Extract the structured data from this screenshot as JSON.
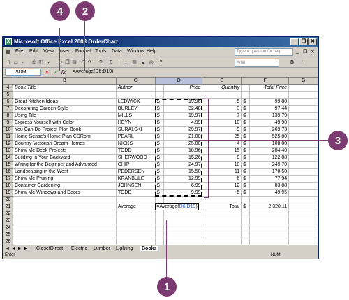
{
  "callouts": {
    "c1": "1",
    "c2": "2",
    "c3": "3",
    "c4": "4"
  },
  "window": {
    "title": "Microsoft Office Excel 2003 OrderChart",
    "app_icon": "X",
    "controls": [
      "_",
      "❐",
      "✕"
    ]
  },
  "menu": {
    "items": [
      "File",
      "Edit",
      "View",
      "Insert",
      "Format",
      "Tools",
      "Data",
      "Window",
      "Help"
    ],
    "ask_placeholder": "Type a question for help",
    "doc_controls": [
      "_",
      "❐",
      "✕"
    ]
  },
  "toolbar": {
    "font_placeholder": "Arial",
    "bold": "B",
    "italic": "I",
    "autosum": "Σ"
  },
  "formula": {
    "namebox": "SUM",
    "cancel": "✕",
    "enter": "✓",
    "fx": "fx",
    "text": "=Average(D6:D19)"
  },
  "sheet": {
    "columns": [
      "B",
      "C",
      "D",
      "E",
      "F",
      "G"
    ],
    "rows": [
      {
        "n": "4",
        "b": "Book Title",
        "c": "Author",
        "d$": "",
        "d": "Price",
        "e": "Quantity",
        "f$": "",
        "f": "Total Price",
        "italic": true
      },
      {
        "n": "5",
        "b": "",
        "c": "",
        "d$": "",
        "d": "",
        "e": "",
        "f$": "",
        "f": ""
      },
      {
        "n": "6",
        "b": "Great Kitchen Ideas",
        "c": "LEDWICK",
        "d$": "$",
        "d": "19.96",
        "e": "5",
        "f$": "$",
        "f": "99.80"
      },
      {
        "n": "7",
        "b": "Decorating Garden Style",
        "c": "BURLEY",
        "d$": "$",
        "d": "32.48",
        "e": "3",
        "f$": "$",
        "f": "97.44"
      },
      {
        "n": "8",
        "b": "Using Tile",
        "c": "MILLS",
        "d$": "$",
        "d": "19.97",
        "e": "7",
        "f$": "$",
        "f": "139.79"
      },
      {
        "n": "9",
        "b": "Express Yourself with Color",
        "c": "HEYN",
        "d$": "$",
        "d": "4.99",
        "e": "10",
        "f$": "$",
        "f": "49.90"
      },
      {
        "n": "10",
        "b": "You Can Do Project Plan Book",
        "c": "SURALSKI",
        "d$": "$",
        "d": "29.97",
        "e": "9",
        "f$": "$",
        "f": "269.73"
      },
      {
        "n": "11",
        "b": "Home Sense's Home Plan CDRom",
        "c": "PEARL",
        "d$": "$",
        "d": "21.00",
        "e": "25",
        "f$": "$",
        "f": "525.00"
      },
      {
        "n": "12",
        "b": "Country Victorian Dream Homes",
        "c": "NICKS",
        "d$": "$",
        "d": "25.00",
        "e": "4",
        "f$": "$",
        "f": "100.00"
      },
      {
        "n": "13",
        "b": "Show Me Deck Projects",
        "c": "TODD",
        "d$": "$",
        "d": "18.96",
        "e": "15",
        "f$": "$",
        "f": "284.40"
      },
      {
        "n": "14",
        "b": "Building in Your Backyard",
        "c": "SHERWOOD",
        "d$": "$",
        "d": "15.26",
        "e": "8",
        "f$": "$",
        "f": "122.08"
      },
      {
        "n": "15",
        "b": "Wiring for the Beginner and Advanced",
        "c": "CHIP",
        "d$": "$",
        "d": "24.97",
        "e": "10",
        "f$": "$",
        "f": "249.70"
      },
      {
        "n": "16",
        "b": "Landscaping in the West",
        "c": "PEDERSEN",
        "d$": "$",
        "d": "15.50",
        "e": "11",
        "f$": "$",
        "f": "170.50"
      },
      {
        "n": "17",
        "b": "Show Me Pruning",
        "c": "KRANBULE",
        "d$": "$",
        "d": "12.99",
        "e": "6",
        "f$": "$",
        "f": "77.94"
      },
      {
        "n": "18",
        "b": "Container Gardening",
        "c": "JOHNSEN",
        "d$": "$",
        "d": "6.99",
        "e": "12",
        "f$": "$",
        "f": "83.88"
      },
      {
        "n": "19",
        "b": "Show Me Windows and Doors",
        "c": "TODD",
        "d$": "$",
        "d": "9.99",
        "e": "5",
        "f$": "$",
        "f": "49.95"
      },
      {
        "n": "20",
        "b": "",
        "c": "",
        "d$": "",
        "d": "",
        "e": "",
        "f$": "",
        "f": ""
      },
      {
        "n": "21",
        "b": "",
        "c": "Average",
        "d$": "",
        "d": "",
        "e": "Total",
        "f$": "$",
        "f": "2,320.11"
      },
      {
        "n": "22",
        "b": "",
        "c": "",
        "d$": "",
        "d": "",
        "e": "",
        "f$": "",
        "f": ""
      },
      {
        "n": "23",
        "b": "",
        "c": "",
        "d$": "",
        "d": "",
        "e": "",
        "f$": "",
        "f": ""
      },
      {
        "n": "24",
        "b": "",
        "c": "",
        "d$": "",
        "d": "",
        "e": "",
        "f$": "",
        "f": ""
      },
      {
        "n": "25",
        "b": "",
        "c": "",
        "d$": "",
        "d": "",
        "e": "",
        "f$": "",
        "f": ""
      },
      {
        "n": "26",
        "b": "",
        "c": "",
        "d$": "",
        "d": "",
        "e": "",
        "f$": "",
        "f": ""
      },
      {
        "n": "27",
        "b": "",
        "c": "",
        "d$": "",
        "d": "",
        "e": "",
        "f$": "",
        "f": ""
      },
      {
        "n": "28",
        "b": "",
        "c": "",
        "d$": "",
        "d": "",
        "e": "",
        "f$": "",
        "f": ""
      },
      {
        "n": "29",
        "b": "",
        "c": "",
        "d$": "",
        "d": "",
        "e": "",
        "f$": "",
        "f": ""
      },
      {
        "n": "30",
        "b": "",
        "c": "",
        "d$": "",
        "d": "",
        "e": "",
        "f$": "",
        "f": ""
      }
    ],
    "edit_cell": {
      "prefix": "=Average(",
      "ref": "D6:D19",
      "suffix": ")"
    }
  },
  "tabs": {
    "nav": "◄ ◄ ► ►|",
    "items": [
      "ClosetDirect",
      "Electric",
      "Lumber",
      "Lighting",
      "Books"
    ],
    "active": "Books"
  },
  "status": {
    "mode": "Enter",
    "num": "NUM"
  }
}
